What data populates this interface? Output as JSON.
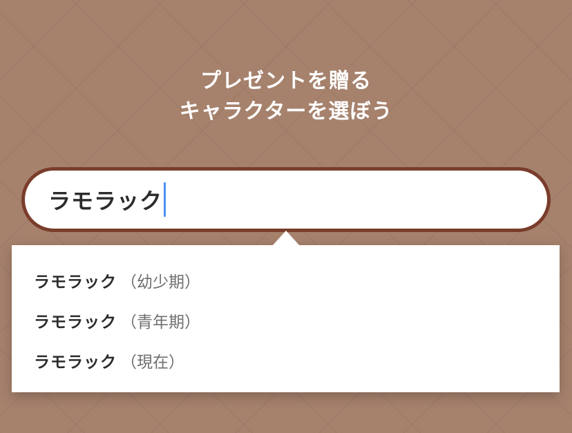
{
  "header": {
    "title_line1": "プレゼントを贈る",
    "title_line2": "キャラクターを選ぼう"
  },
  "search": {
    "value": "ラモラック"
  },
  "suggestions": [
    {
      "name": "ラモラック",
      "detail": "（幼少期）"
    },
    {
      "name": "ラモラック",
      "detail": "（青年期）"
    },
    {
      "name": "ラモラック",
      "detail": "（現在）"
    }
  ],
  "colors": {
    "background": "#a6826d",
    "search_border": "#7a3d2b",
    "caret": "#4c8ff5",
    "text": "#2b2b2b"
  }
}
